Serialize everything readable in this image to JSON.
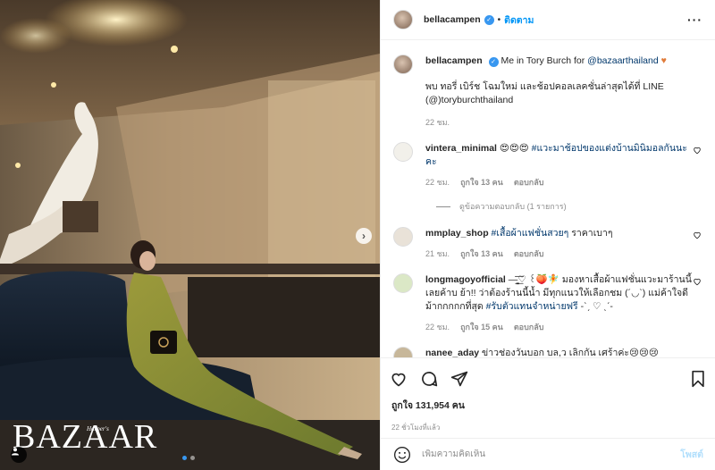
{
  "post": {
    "username": "bellacampen",
    "follow_label": "ติดตาม",
    "more_icon": "more-horizontal-icon",
    "caption_text": "Me in Tory Burch for",
    "caption_mention": "@bazaarthailand",
    "caption_line2": "พบ ทอรี่ เบิร์ช โฉมใหม่ และช้อปคอลเลคชั่นล่าสุดได้ที่ LINE (@)toryburchthailand",
    "caption_time": "22 ชม."
  },
  "image": {
    "brand_text": "BAZAAR",
    "brand_small": "Harper's",
    "next_icon": "chevron-right-icon",
    "user_tag_icon": "user-tag-icon",
    "slide_count": 2,
    "active_slide": 1
  },
  "comments": [
    {
      "username": "vintera_minimal",
      "text": "😍😍😍 ",
      "hashtag": "#แวะมาช้อปของแต่งบ้านมินิมอลกันนะคะ",
      "time": "22 ชม.",
      "likes": "ถูกใจ 13 คน",
      "reply_label": "ตอบกลับ",
      "view_replies": "ดูข้อความตอบกลับ (1 รายการ)"
    },
    {
      "username": "mmplay_shop",
      "text": "",
      "hashtag": "#เสื้อผ้าแฟชั่นสวยๆ",
      "text_after": " ราคาเบาๆ",
      "time": "21 ชม.",
      "likes": "ถูกใจ 13 คน",
      "reply_label": "ตอบกลับ"
    },
    {
      "username": "longmagoyofficial",
      "text": "—̳͟͞͞♡ ꒰🍑🧚 มองหาเสื้อผ้าแฟชั่นแวะมาร้านนี้เลยค้าบ ย้า!! ว่าต้องร้านนี้น้ำ มีทุกแนวให้เลือกชม (´◡`) แม่ค้าใจดีม้ากกกกกที่สุด ",
      "hashtag": "#รับตัวแทนจำหน่ายฟรี",
      "text_after": " -ˋˏ ♡ ˎˊ-",
      "time": "22 ชม.",
      "likes": "ถูกใจ 15 คน",
      "reply_label": "ตอบกลับ"
    },
    {
      "username": "nanee_aday",
      "text": "ข่าวช่องวันบอก บล,ว เลิกกัน เศร้าค่ะ😢😢😢"
    }
  ],
  "actions": {
    "like_icon": "heart-icon",
    "comment_icon": "comment-icon",
    "share_icon": "share-icon",
    "bookmark_icon": "bookmark-icon",
    "likes_text": "ถูกใจ 131,954 คน",
    "time_ago": "22 ชั่วโมงที่แล้ว"
  },
  "add_comment": {
    "placeholder": "เพิ่มความคิดเห็น",
    "post_label": "โพสต์",
    "emoji_icon": "emoji-icon"
  },
  "colors": {
    "accent": "#0095f6",
    "verified": "#3897f0",
    "muted": "#8e8e8e",
    "post_disabled": "#b2dffc",
    "heart": "#e07b39"
  }
}
